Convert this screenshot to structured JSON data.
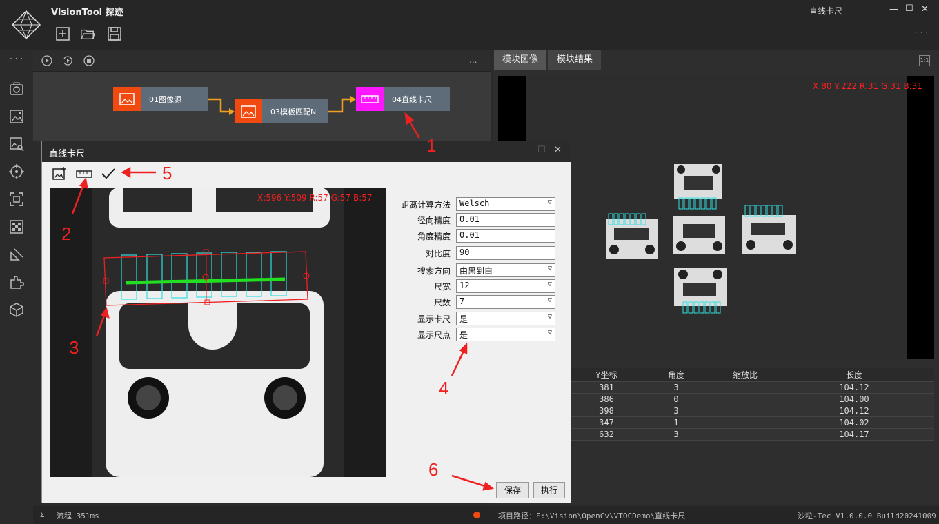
{
  "app": {
    "title": "VisionTool 探迹",
    "window_title": "直线卡尺"
  },
  "flow": {
    "nodes": [
      {
        "label": "01图像源",
        "color": "#f04a10"
      },
      {
        "label": "03模板匹配N",
        "color": "#f04a10"
      },
      {
        "label": "04直线卡尺",
        "color": "#ff18ff"
      }
    ],
    "toolbar_more": "..."
  },
  "right": {
    "tabs": [
      "模块图像",
      "模块结果"
    ],
    "zoom_label": "1:1",
    "coord": "X:80 Y:222  R:31 G:31 B:31",
    "table": {
      "headers": [
        "Y坐标",
        "角度",
        "缩放比",
        "长度"
      ],
      "rows": [
        [
          "381",
          "3",
          "",
          "104.12"
        ],
        [
          "386",
          "0",
          "",
          "104.00"
        ],
        [
          "398",
          "3",
          "",
          "104.12"
        ],
        [
          "347",
          "1",
          "",
          "104.02"
        ],
        [
          "632",
          "3",
          "",
          "104.17"
        ]
      ]
    }
  },
  "dialog": {
    "title": "直线卡尺",
    "coord": "X:596 Y:509  R:57 G:57 B:57",
    "params": [
      {
        "label": "距离计算方法",
        "value": "Welsch",
        "dropdown": true
      },
      {
        "label": "径向精度",
        "value": "0.01",
        "dropdown": false
      },
      {
        "label": "角度精度",
        "value": "0.01",
        "dropdown": false
      },
      {
        "label": "对比度",
        "value": "90",
        "dropdown": false
      },
      {
        "label": "搜索方向",
        "value": "由黑到白",
        "dropdown": true
      },
      {
        "label": "尺宽",
        "value": "12",
        "dropdown": true
      },
      {
        "label": "尺数",
        "value": "7",
        "dropdown": true
      },
      {
        "label": "显示卡尺",
        "value": "是",
        "dropdown": true
      },
      {
        "label": "显示尺点",
        "value": "是",
        "dropdown": true
      }
    ],
    "save_label": "保存",
    "run_label": "执行"
  },
  "annotations": [
    "1",
    "2",
    "3",
    "4",
    "5",
    "6"
  ],
  "status": {
    "flow": "流程 351ms",
    "path": "项目路径：E:\\Vision\\OpenCv\\VTOCDemo\\直线卡尺",
    "version": "沙粒-Tec V1.0.0.0 Build20241009"
  },
  "colors": {
    "accent_orange": "#f04a10",
    "accent_magenta": "#ff18ff",
    "annotation_red": "#ee2020",
    "caliper_cyan": "#30e0e0"
  }
}
